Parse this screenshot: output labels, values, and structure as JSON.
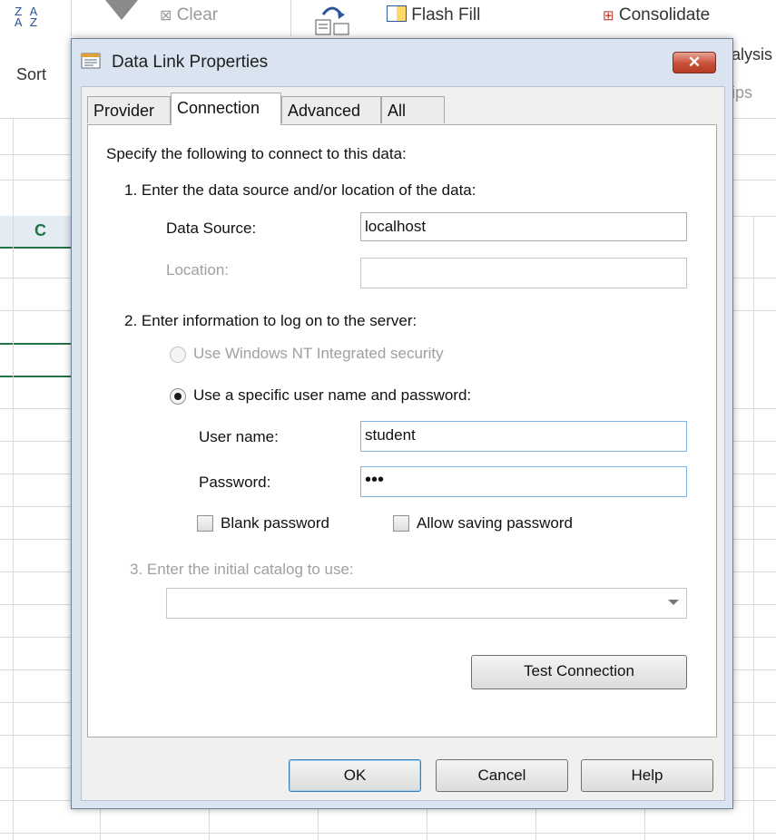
{
  "ribbon": {
    "sort_az_top": "Z A",
    "sort_az_bottom": "A Z",
    "sort_label": "Sort",
    "clear_label": "Clear",
    "flash_fill_label": "Flash Fill",
    "consolidate_label": "Consolidate",
    "analysis_partial": "alysis",
    "tips_partial": "ips"
  },
  "sheet": {
    "column_c_label": "C",
    "accent_color": "#217346"
  },
  "dialog": {
    "title": "Data Link Properties",
    "close_glyph": "✕",
    "tabs": [
      {
        "label": "Provider"
      },
      {
        "label": "Connection"
      },
      {
        "label": "Advanced"
      },
      {
        "label": "All"
      }
    ],
    "active_tab": "Connection",
    "intro": "Specify the following to connect to this data:",
    "step1": {
      "label": "1. Enter the data source and/or location of the data:",
      "data_source_label": "Data Source:",
      "data_source_value": "localhost",
      "location_label": "Location:",
      "location_value": ""
    },
    "step2": {
      "label": "2. Enter information to log on to the server:",
      "nt_security_label": "Use Windows NT Integrated security",
      "specific_user_label": "Use a specific user name and password:",
      "username_label": "User name:",
      "username_value": "student",
      "password_label": "Password:",
      "password_value": "•••",
      "blank_password_label": "Blank password",
      "allow_saving_label": "Allow saving password"
    },
    "step3": {
      "label": "3. Enter the initial catalog to use:",
      "catalog_value": ""
    },
    "test_connection_label": "Test Connection",
    "buttons": {
      "ok": "OK",
      "cancel": "Cancel",
      "help": "Help"
    }
  }
}
